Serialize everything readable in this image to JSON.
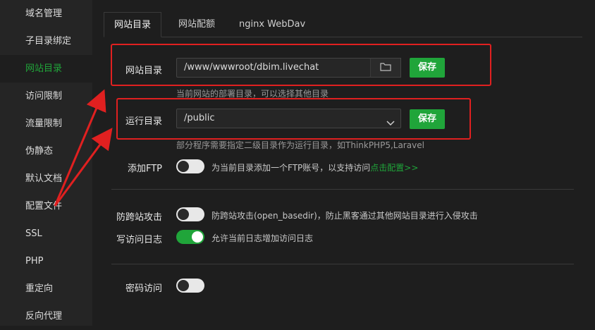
{
  "sidebar": {
    "items": [
      {
        "label": "域名管理"
      },
      {
        "label": "子目录绑定"
      },
      {
        "label": "网站目录"
      },
      {
        "label": "访问限制"
      },
      {
        "label": "流量限制"
      },
      {
        "label": "伪静态"
      },
      {
        "label": "默认文档"
      },
      {
        "label": "配置文件"
      },
      {
        "label": "SSL"
      },
      {
        "label": "PHP"
      },
      {
        "label": "重定向"
      },
      {
        "label": "反向代理"
      }
    ],
    "active_index": 2
  },
  "tabs": [
    {
      "label": "网站目录"
    },
    {
      "label": "网站配额"
    },
    {
      "label": "nginx WebDav"
    }
  ],
  "site_dir": {
    "label": "网站目录",
    "value": "/www/wwwroot/dbim.livechat",
    "save_label": "保存",
    "hint": "当前网站的部署目录，可以选择其他目录"
  },
  "run_dir": {
    "label": "运行目录",
    "value": "/public",
    "save_label": "保存",
    "hint": "部分程序需要指定二级目录作为运行目录，如ThinkPHP5,Laravel"
  },
  "ftp": {
    "label": "添加FTP",
    "state": "off",
    "desc": "为当前目录添加一个FTP账号，以支持访问",
    "link": "点击配置>>"
  },
  "anti_cross": {
    "label": "防跨站攻击",
    "state": "off",
    "desc": "防跨站攻击(open_basedir)，防止黑客通过其他网站目录进行入侵攻击"
  },
  "access_log": {
    "label": "写访问日志",
    "state": "on",
    "desc": "允许当前日志增加访问日志"
  },
  "password_access": {
    "label": "密码访问",
    "state": "off"
  },
  "colors": {
    "accent": "#20a53a",
    "annotation": "#e02020",
    "background": "#1e1e1e",
    "sidebar": "#252525"
  },
  "icons": {
    "folder": "folder-icon",
    "dropdown": "chevron-down-icon"
  }
}
